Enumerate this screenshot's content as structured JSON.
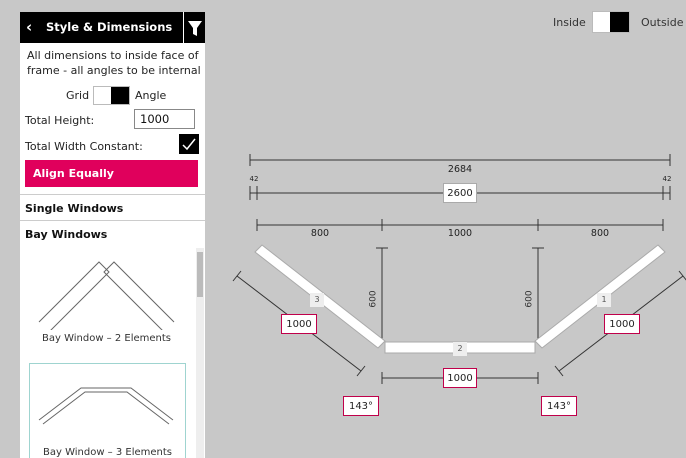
{
  "panel": {
    "title": "Style & Dimensions",
    "note": "All dimensions to inside face of frame - all angles to be internal",
    "grid_label": "Grid",
    "angle_label": "Angle",
    "total_height_label": "Total Height:",
    "total_height_value": "1000",
    "total_width_label": "Total Width Constant:",
    "align_button": "Align Equally",
    "sections": [
      "Single Windows",
      "Bay Windows"
    ],
    "cards": [
      "Bay Window – 2 Elements",
      "Bay Window – 3 Elements"
    ]
  },
  "view_toggle": {
    "inside": "Inside",
    "outside": "Outside"
  },
  "drawing": {
    "overall_width": "2684",
    "left_offset": "42",
    "right_offset": "42",
    "inner_width": "2600",
    "seg_left": "800",
    "seg_mid": "1000",
    "seg_right": "800",
    "depth_left": "600",
    "depth_right": "600",
    "pane_left_num": "3",
    "pane_mid_num": "2",
    "pane_right_num": "1",
    "pane_left_len": "1000",
    "pane_mid_len": "1000",
    "pane_right_len": "1000",
    "angle_left": "143°",
    "angle_right": "143°"
  },
  "colors": {
    "accent": "#e0005c",
    "canvas": "#c8c8c8",
    "header": "#000000"
  },
  "icons": [
    "chevron-left-icon",
    "filter-icon",
    "checkmark-icon"
  ]
}
